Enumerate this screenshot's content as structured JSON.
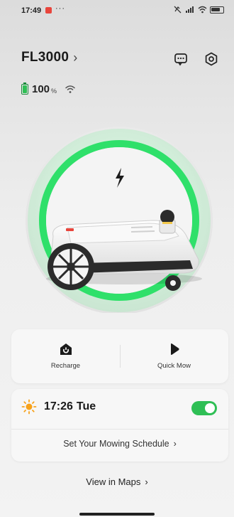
{
  "status_bar": {
    "time": "17:49",
    "more": "···",
    "right_icons": [
      "mute-icon",
      "signal-icon",
      "wifi-icon",
      "battery-icon"
    ]
  },
  "header": {
    "device_name": "FL3000",
    "chevron": "›",
    "chat_icon": "chat-icon",
    "settings_icon": "settings-icon"
  },
  "battery": {
    "value": "100",
    "unit": "%",
    "wifi_icon": "wifi-icon"
  },
  "hero": {
    "charge_icon": "lightning-bolt-icon",
    "ring_color": "#2fe06a",
    "robot": "lawn-mower-robot"
  },
  "actions": [
    {
      "label": "Recharge",
      "icon": "recharge-icon"
    },
    {
      "label": "Quick Mow",
      "icon": "play-icon"
    }
  ],
  "schedule": {
    "icon": "sun-icon",
    "time": "17:26",
    "day": "Tue",
    "enabled": true,
    "link_label": "Set Your Mowing Schedule",
    "link_chevron": "›"
  },
  "maps": {
    "label": "View in Maps",
    "chevron": "›"
  },
  "colors": {
    "accent_green": "#2fbf55",
    "sun_orange": "#f7a21b",
    "status_red": "#e8453c"
  }
}
